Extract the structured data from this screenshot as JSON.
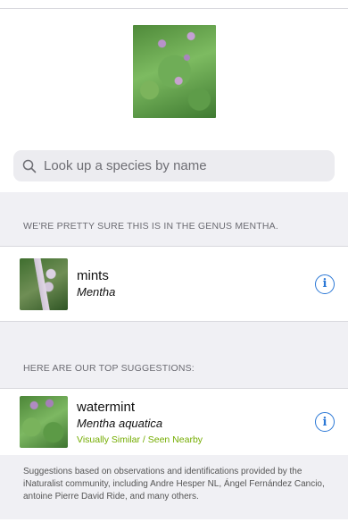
{
  "search": {
    "placeholder": "Look up a species by name"
  },
  "genus_section": {
    "header": "WE'RE PRETTY SURE THIS IS IN THE GENUS MENTHA.",
    "item": {
      "common_name": "mints",
      "scientific_name": "Mentha"
    }
  },
  "suggestions_section": {
    "header": "HERE ARE OUR TOP SUGGESTIONS:",
    "items": [
      {
        "common_name": "watermint",
        "scientific_name": "Mentha aquatica",
        "reason": "Visually Similar / Seen Nearby"
      }
    ]
  },
  "footer": {
    "text": "Suggestions based on observations and identifications provided by the iNaturalist community, including Andre Hesper NL, Ángel Fernández Cancio, antoine Pierre David Ride, and many others."
  },
  "colors": {
    "info_blue": "#2b78d6",
    "reason_green": "#74ac00",
    "group_background": "#f0f0f4"
  },
  "icons": {
    "search": "magnifier",
    "info": "circled-i"
  }
}
